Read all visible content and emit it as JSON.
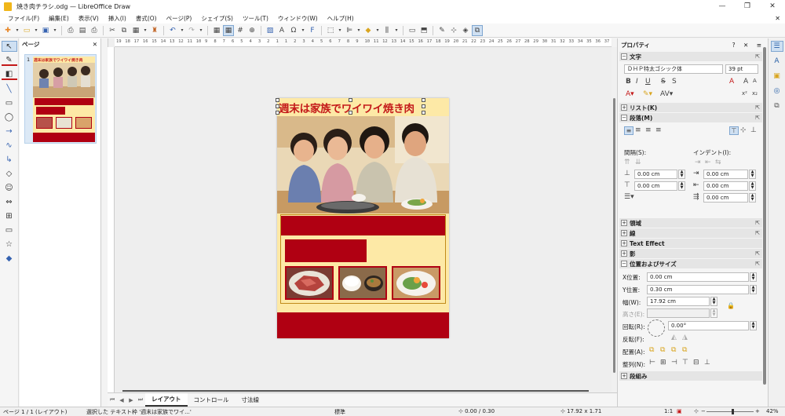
{
  "window": {
    "title": "焼き肉チラシ.odg — LibreOffice Draw",
    "buttons": [
      "—",
      "❐",
      "✕"
    ]
  },
  "menu": {
    "items": [
      "ファイル(F)",
      "編集(E)",
      "表示(V)",
      "挿入(I)",
      "書式(O)",
      "ページ(P)",
      "シェイプ(S)",
      "ツール(T)",
      "ウィンドウ(W)",
      "ヘルプ(H)"
    ],
    "close": "✕"
  },
  "pages_pane": {
    "title": "ページ",
    "close": "✕",
    "thumb_number": "1",
    "thumb_title": "週末は家族でワイワイ焼き肉"
  },
  "ruler": {
    "labels": [
      "19",
      "18",
      "17",
      "16",
      "15",
      "14",
      "13",
      "12",
      "11",
      "10",
      "9",
      "8",
      "7",
      "6",
      "5",
      "4",
      "3",
      "2",
      "1",
      "1",
      "2",
      "3",
      "4",
      "5",
      "6",
      "7",
      "8",
      "9",
      "10",
      "11",
      "12",
      "13",
      "14",
      "15",
      "16",
      "17",
      "18",
      "19",
      "20",
      "21",
      "22",
      "23",
      "24",
      "25",
      "26",
      "27",
      "28",
      "29",
      "30",
      "31",
      "32",
      "33",
      "34",
      "35",
      "36",
      "37"
    ]
  },
  "flyer": {
    "title": "週末は家族でワイワイ焼き肉"
  },
  "tabs": {
    "items": [
      "レイアウト",
      "コントロール",
      "寸法線"
    ],
    "active": "レイアウト"
  },
  "sidebar": {
    "title": "プロパティ",
    "controls": "? ✕ ≡",
    "sections": {
      "character": "文字",
      "list": "リスト(K)",
      "paragraph": "段落(M)",
      "area": "領域",
      "line": "線",
      "text_effect": "Text Effect",
      "shadow": "影",
      "position_size": "位置およびサイズ",
      "columns": "段組み"
    },
    "font_name": "ＤＨＰ特太ゴシック体",
    "font_size": "39 pt",
    "spacing_label": "間隔(S):",
    "indent_label": "インデント(I):",
    "spacing_above": "0.00 cm",
    "spacing_below": "0.00 cm",
    "indent_before": "0.00 cm",
    "indent_after": "0.00 cm",
    "first_line": "0.00 cm",
    "pos_x_label": "X位置:",
    "pos_x": "0.00 cm",
    "pos_y_label": "Y位置:",
    "pos_y": "0.30 cm",
    "width_label": "幅(W):",
    "width": "17.92 cm",
    "height_label": "高さ(E):",
    "height": "",
    "rotation_label": "回転(R):",
    "rotation": "0.00°",
    "flip_label": "反転(F):",
    "arrange_label": "配置(A):",
    "align_label": "整列(N):"
  },
  "statusbar": {
    "page": "ページ 1 / 1 (レイアウト)",
    "selection": "選択した テキスト枠 '週末は家族でワイ...'",
    "style": "標準",
    "position": "0.00 / 0.30",
    "size": "17.92 x 1.71",
    "scale": "1:1",
    "zoom": "42%"
  }
}
